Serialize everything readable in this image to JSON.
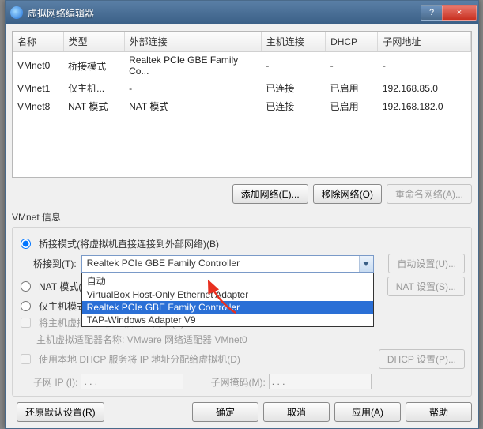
{
  "titlebar": {
    "title": "虚拟网络编辑器",
    "help": "?",
    "close": "×"
  },
  "columns": [
    "名称",
    "类型",
    "外部连接",
    "主机连接",
    "DHCP",
    "子网地址"
  ],
  "rows": [
    {
      "name": "VMnet0",
      "type": "桥接模式",
      "ext": "Realtek PCIe GBE Family Co...",
      "host": "-",
      "dhcp": "-",
      "subnet": "-"
    },
    {
      "name": "VMnet1",
      "type": "仅主机...",
      "ext": "-",
      "host": "已连接",
      "dhcp": "已启用",
      "subnet": "192.168.85.0"
    },
    {
      "name": "VMnet8",
      "type": "NAT 模式",
      "ext": "NAT 模式",
      "host": "已连接",
      "dhcp": "已启用",
      "subnet": "192.168.182.0"
    }
  ],
  "colwidth": {
    "name": 60,
    "type": 72,
    "ext": 162,
    "host": 76,
    "dhcp": 62,
    "subnet": 110
  },
  "buttons": {
    "add": "添加网络(E)...",
    "remove": "移除网络(O)",
    "rename": "重命名网络(A)...",
    "auto": "自动设置(U)...",
    "nat": "NAT 设置(S)...",
    "dhcp": "DHCP 设置(P)...",
    "restore": "还原默认设置(R)",
    "ok": "确定",
    "cancel": "取消",
    "apply": "应用(A)",
    "help": "帮助"
  },
  "info": {
    "group_title": "VMnet 信息",
    "bridge_radio": "桥接模式(将虚拟机直接连接到外部网络)(B)",
    "bridge_to": "桥接到(T):",
    "bridge_selected": "Realtek PCIe GBE Family Controller",
    "dropdown": [
      {
        "label": "自动",
        "sel": false
      },
      {
        "label": "VirtualBox Host-Only Ethernet Adapter",
        "sel": false
      },
      {
        "label": "Realtek PCIe GBE Family Controller",
        "sel": true
      },
      {
        "label": "TAP-Windows Adapter V9",
        "sel": false
      }
    ],
    "nat_radio": "NAT 模式(与",
    "hostonly_radio": "仅主机模式",
    "host_connect_cb": "将主机虚拟适配器连接到此网络(V)",
    "host_adapter": "主机虚拟适配器名称: VMware 网络适配器 VMnet0",
    "dhcp_cb": "使用本地 DHCP 服务将 IP 地址分配给虚拟机(D)",
    "subnet_ip_label": "子网 IP (I):",
    "subnet_mask_label": "子网掩码(M):",
    "ip_placeholder": ". . ."
  }
}
